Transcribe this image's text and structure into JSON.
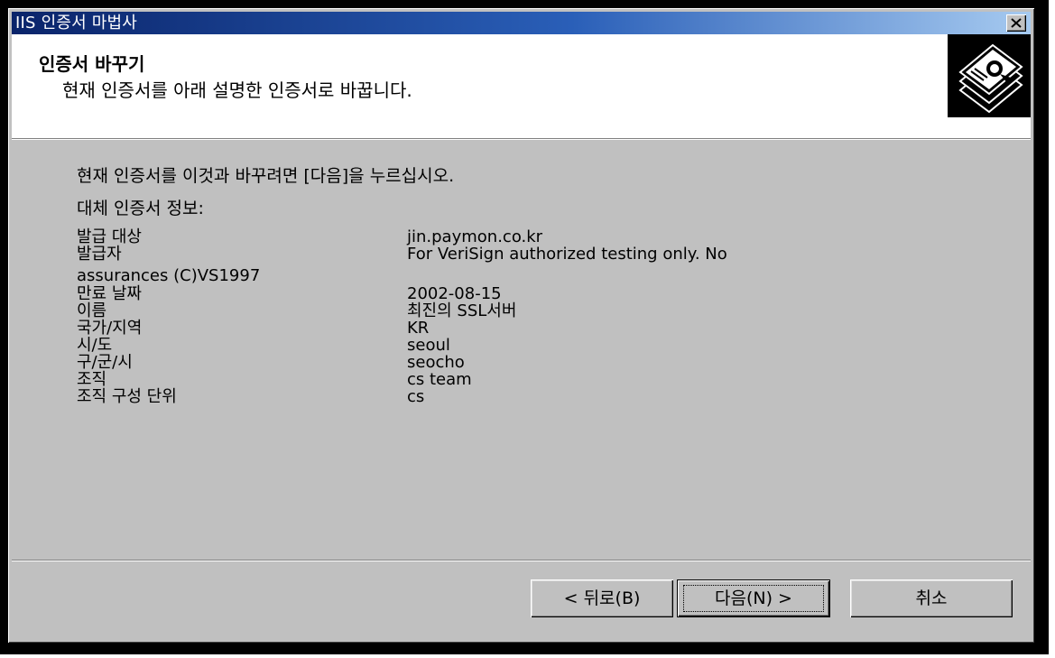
{
  "window": {
    "title": "IIS 인증서 마법사"
  },
  "header": {
    "title": "인증서 바꾸기",
    "subtitle": "현재 인증서를 아래 설명한 인증서로 바꿉니다.",
    "icon": "certificate-stack-icon"
  },
  "body": {
    "instruction": "현재 인증서를 이것과 바꾸려면 [다음]을 누르십시오.",
    "details_heading": "대체 인증서 정보:",
    "rows": [
      {
        "label": "발급 대상",
        "value": "jin.paymon.co.kr"
      },
      {
        "label": "발급자",
        "value": "For VeriSign authorized testing only. No"
      },
      {
        "label": "assurances (C)VS1997",
        "value": ""
      },
      {
        "label": "만료 날짜",
        "value": "2002-08-15"
      },
      {
        "label": "이름",
        "value": "최진의 SSL서버"
      },
      {
        "label": "국가/지역",
        "value": "KR"
      },
      {
        "label": "시/도",
        "value": "seoul"
      },
      {
        "label": "구/군/시",
        "value": "seocho"
      },
      {
        "label": "조직",
        "value": "cs team"
      },
      {
        "label": "조직 구성 단위",
        "value": "cs"
      }
    ]
  },
  "buttons": {
    "back": "< 뒤로(B)",
    "next": "다음(N) >",
    "cancel": "취소"
  },
  "colors": {
    "titlebar_start": "#0a246a",
    "titlebar_end": "#a6caf0",
    "dialog_face": "#c0c0c0"
  }
}
